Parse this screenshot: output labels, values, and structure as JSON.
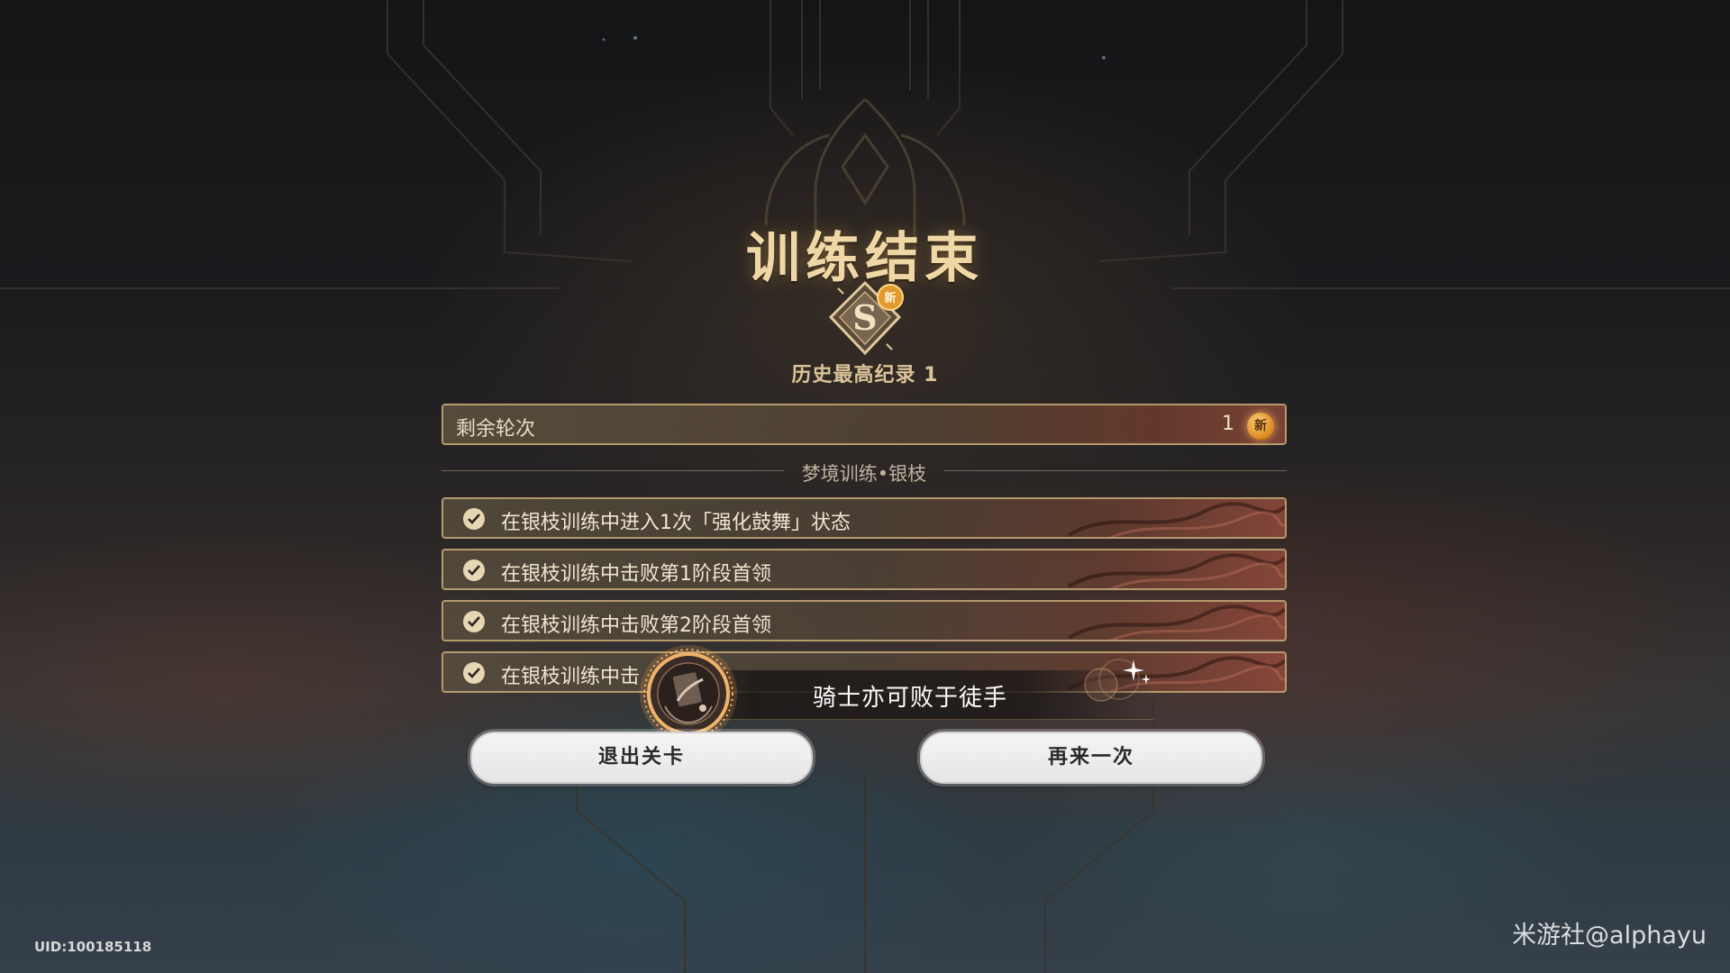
{
  "screen": {
    "title": "训练结束",
    "grade": "S",
    "new_tag": "新",
    "record_label": "历史最高纪录",
    "record_value": "1",
    "record_text": "历史最高纪录 1"
  },
  "rounds": {
    "label": "剩余轮次",
    "value": "1",
    "new_tag": "新"
  },
  "section": {
    "title": "梦境训练•银枝"
  },
  "tasks": [
    {
      "text": "在银枝训练中进入1次「强化鼓舞」状态",
      "completed": true
    },
    {
      "text": "在银枝训练中击败第1阶段首领",
      "completed": true
    },
    {
      "text": "在银枝训练中击败第2阶段首领",
      "completed": true
    },
    {
      "text": "在银枝训练中击",
      "completed": true
    }
  ],
  "achievement": {
    "name": "骑士亦可败于徒手",
    "icon": "achievement-medal-icon"
  },
  "buttons": {
    "exit": "退出关卡",
    "retry": "再来一次"
  },
  "footer": {
    "uid": "UID:100185118",
    "watermark": "米游社@alphayu"
  },
  "colors": {
    "title_gold": "#efd8a6",
    "bar_border": "#b59a6d",
    "button_bg": "#f0f0f0",
    "new_tag_orange": "#d9861e"
  }
}
